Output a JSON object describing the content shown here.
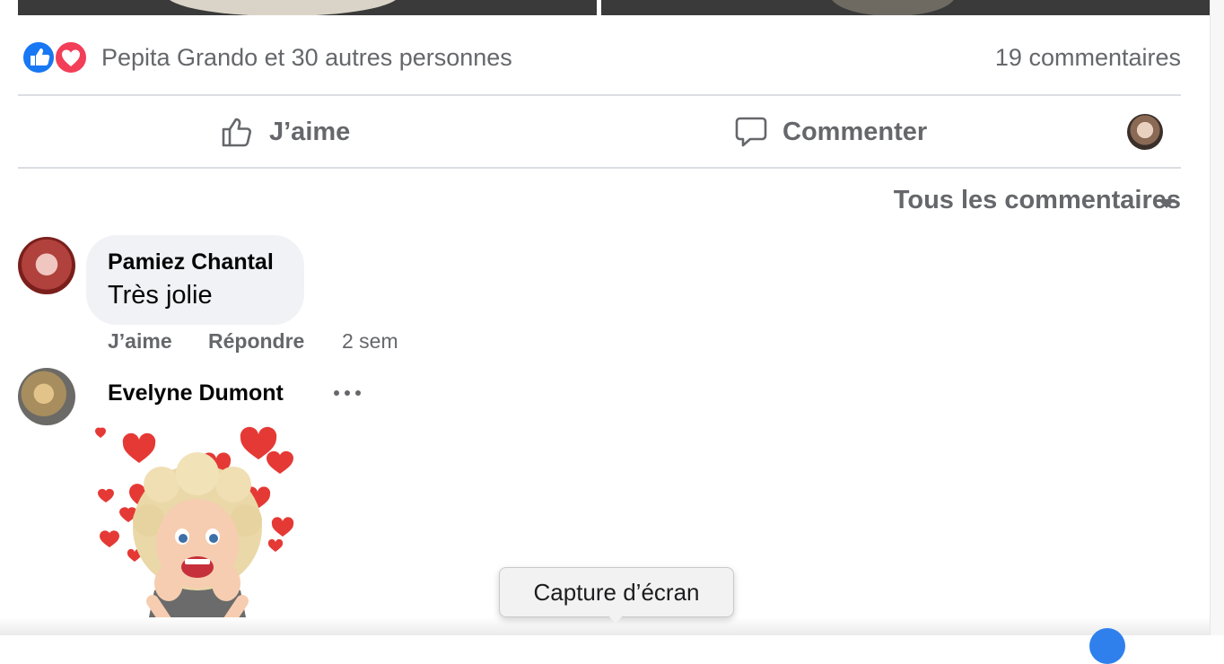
{
  "reactions": {
    "icons": [
      "like-icon",
      "love-icon"
    ],
    "summary": "Pepita Grando et 30 autres personnes",
    "comments_count": "19 commentaires"
  },
  "actions": {
    "like_label": "J’aime",
    "comment_label": "Commenter"
  },
  "filter": {
    "label": "Tous les commentaires"
  },
  "comments": [
    {
      "author": "Pamiez Chantal",
      "text": "Très jolie",
      "like_label": "J’aime",
      "reply_label": "Répondre",
      "time": "2 sem"
    },
    {
      "author": "Evelyne Dumont",
      "sticker": "hearts-avatar-sticker"
    }
  ],
  "tooltip": {
    "label": "Capture d’écran"
  },
  "colors": {
    "like_blue": "#1877f2",
    "love_red": "#f33e58",
    "secondary_text": "#65676b",
    "bubble_bg": "#f0f2f5"
  }
}
